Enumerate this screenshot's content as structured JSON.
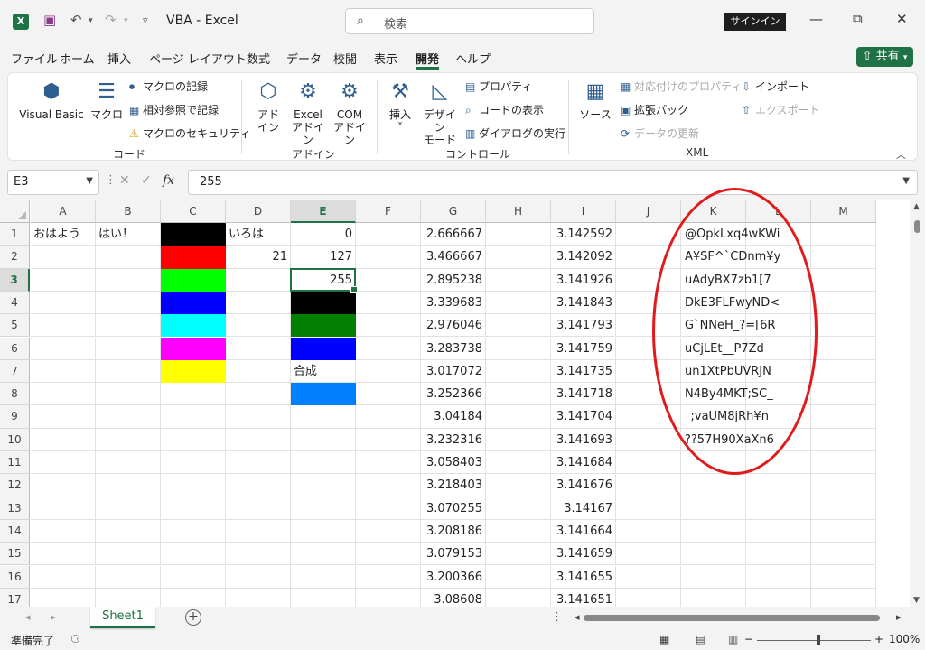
{
  "app": {
    "logo_letter": "X",
    "doc_name": "VBA",
    "app_name": "Excel",
    "separator": " - "
  },
  "qa": {
    "save_icon": "💾",
    "undo_icon": "↶",
    "redo_icon": "↷",
    "more_icon": "⌄"
  },
  "search": {
    "placeholder": "検索",
    "icon": "⌕"
  },
  "signin": "サインイン",
  "window": {
    "min": "—",
    "max": "⧉",
    "close": "✕"
  },
  "menu": [
    "ファイル",
    "ホーム",
    "挿入",
    "ページ レイアウト",
    "数式",
    "データ",
    "校閲",
    "表示",
    "開発",
    "ヘルプ"
  ],
  "share": "共有",
  "ribbon": {
    "code": {
      "label": "コード",
      "visual_basic": "Visual Basic",
      "macro": "マクロ",
      "record_macro": "マクロの記録",
      "relative_ref": "相対参照で記録",
      "macro_security": "マクロのセキュリティ"
    },
    "addins": {
      "label": "アドイン",
      "addin_1": "アド",
      "addin_2": "イン",
      "excel_1": "Excel",
      "excel_2": "アドイン",
      "com_1": "COM",
      "com_2": "アドイン"
    },
    "controls": {
      "label": "コントロール",
      "insert": "挿入",
      "design_1": "デザイン",
      "design_2": "モード",
      "properties": "プロパティ",
      "view_code": "コードの表示",
      "run_dialog": "ダイアログの実行"
    },
    "xml": {
      "label": "XML",
      "source": "ソース",
      "map_props": "対応付けのプロパティ",
      "expansion": "拡張パック",
      "refresh": "データの更新",
      "import": "インポート",
      "export": "エクスポート"
    }
  },
  "formula": {
    "name_box": "E3",
    "fx": "fx",
    "cancel": "✕",
    "enter": "✓",
    "value": "255"
  },
  "columns": [
    "A",
    "B",
    "C",
    "D",
    "E",
    "F",
    "G",
    "H",
    "I",
    "J",
    "K",
    "L",
    "M"
  ],
  "rows": [
    "1",
    "2",
    "3",
    "4",
    "5",
    "6",
    "7",
    "8",
    "9",
    "10",
    "11",
    "12",
    "13",
    "14",
    "15",
    "16",
    "17"
  ],
  "selected_cell": "E3",
  "cells": {
    "A1": "おはよう",
    "B1": "はい！",
    "D1": "いろは",
    "D2": "21",
    "E1": "0",
    "E2": "127",
    "E3": "255",
    "E7": "合成"
  },
  "fills": {
    "C1": "#000000",
    "C2": "#ff0000",
    "C3": "#00ff00",
    "C4": "#0000ff",
    "C5": "#00ffff",
    "C6": "#ff00ff",
    "C7": "#ffff00",
    "E4": "#000000",
    "E5": "#007f00",
    "E6": "#0000ff",
    "E8": "#007fff"
  },
  "col_g": [
    "2.666667",
    "3.466667",
    "2.895238",
    "3.339683",
    "2.976046",
    "3.283738",
    "3.017072",
    "3.252366",
    "3.04184",
    "3.232316",
    "3.058403",
    "3.218403",
    "3.070255",
    "3.208186",
    "3.079153",
    "3.200366",
    "3.08608"
  ],
  "col_i": [
    "3.142592",
    "3.142092",
    "3.141926",
    "3.141843",
    "3.141793",
    "3.141759",
    "3.141735",
    "3.141718",
    "3.141704",
    "3.141693",
    "3.141684",
    "3.141676",
    "3.14167",
    "3.141664",
    "3.141659",
    "3.141655",
    "3.141651"
  ],
  "col_k": [
    "@OpkLxq4wKWi",
    "A¥SF^`CDnm¥y",
    "uAdyBX7zb1[7",
    "DkE3FLFwyND<",
    "G`NNeH_?=[6R",
    "uCjLEt__P7Zd",
    "un1XtPbUVRJN",
    "N4By4MKT;SC_",
    "_;vaUM8jRh¥n",
    "??57H90XaXn6"
  ],
  "annotation_color": "#e11b1b",
  "sheets": [
    "Sheet1"
  ],
  "status": {
    "ready": "準備完了",
    "zoom": "100%"
  }
}
